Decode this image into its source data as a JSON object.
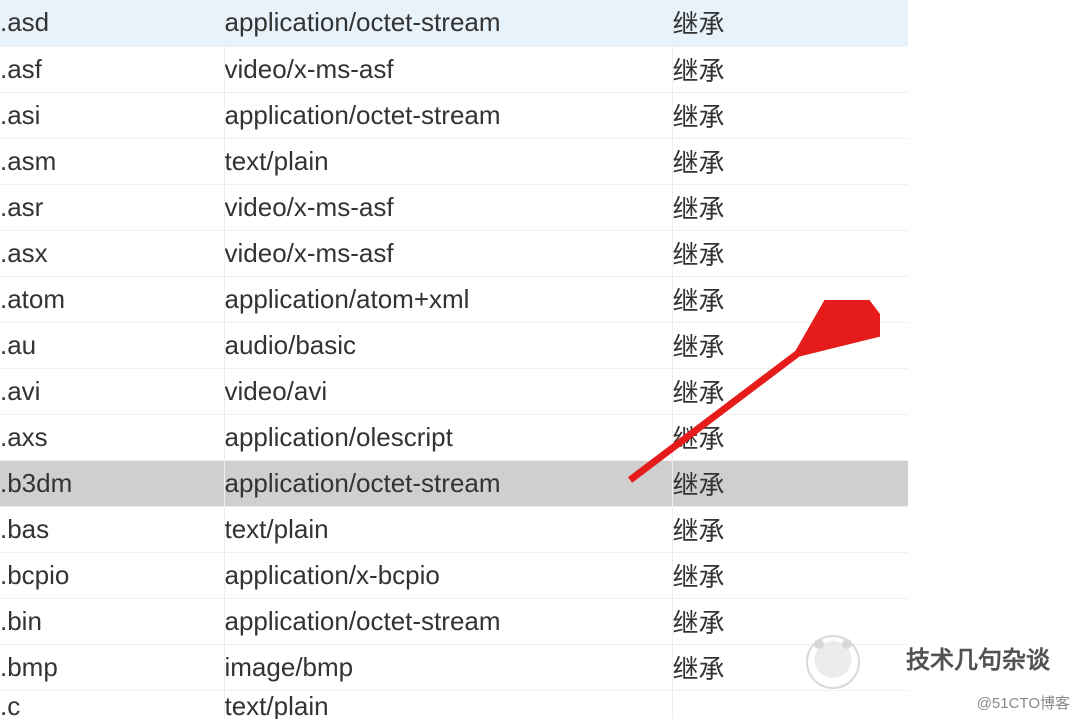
{
  "colors": {
    "selected_light": "#e8f2fb",
    "selected_dark": "#cfcfcf",
    "arrow": "#e61b1b"
  },
  "inherit_label": "继承",
  "rows": [
    {
      "ext": ".asd",
      "mime": "application/octet-stream",
      "sel": "light"
    },
    {
      "ext": ".asf",
      "mime": "video/x-ms-asf"
    },
    {
      "ext": ".asi",
      "mime": "application/octet-stream"
    },
    {
      "ext": ".asm",
      "mime": "text/plain"
    },
    {
      "ext": ".asr",
      "mime": "video/x-ms-asf"
    },
    {
      "ext": ".asx",
      "mime": "video/x-ms-asf"
    },
    {
      "ext": ".atom",
      "mime": "application/atom+xml"
    },
    {
      "ext": ".au",
      "mime": "audio/basic"
    },
    {
      "ext": ".avi",
      "mime": "video/avi"
    },
    {
      "ext": ".axs",
      "mime": "application/olescript"
    },
    {
      "ext": ".b3dm",
      "mime": "application/octet-stream",
      "sel": "dark"
    },
    {
      "ext": ".bas",
      "mime": "text/plain"
    },
    {
      "ext": ".bcpio",
      "mime": "application/x-bcpio"
    },
    {
      "ext": ".bin",
      "mime": "application/octet-stream"
    },
    {
      "ext": ".bmp",
      "mime": "image/bmp"
    },
    {
      "ext": ".c",
      "mime": "text/plain",
      "cut": true
    }
  ],
  "watermark": {
    "line1": "技术几句杂谈",
    "line2": "@51CTO博客"
  }
}
